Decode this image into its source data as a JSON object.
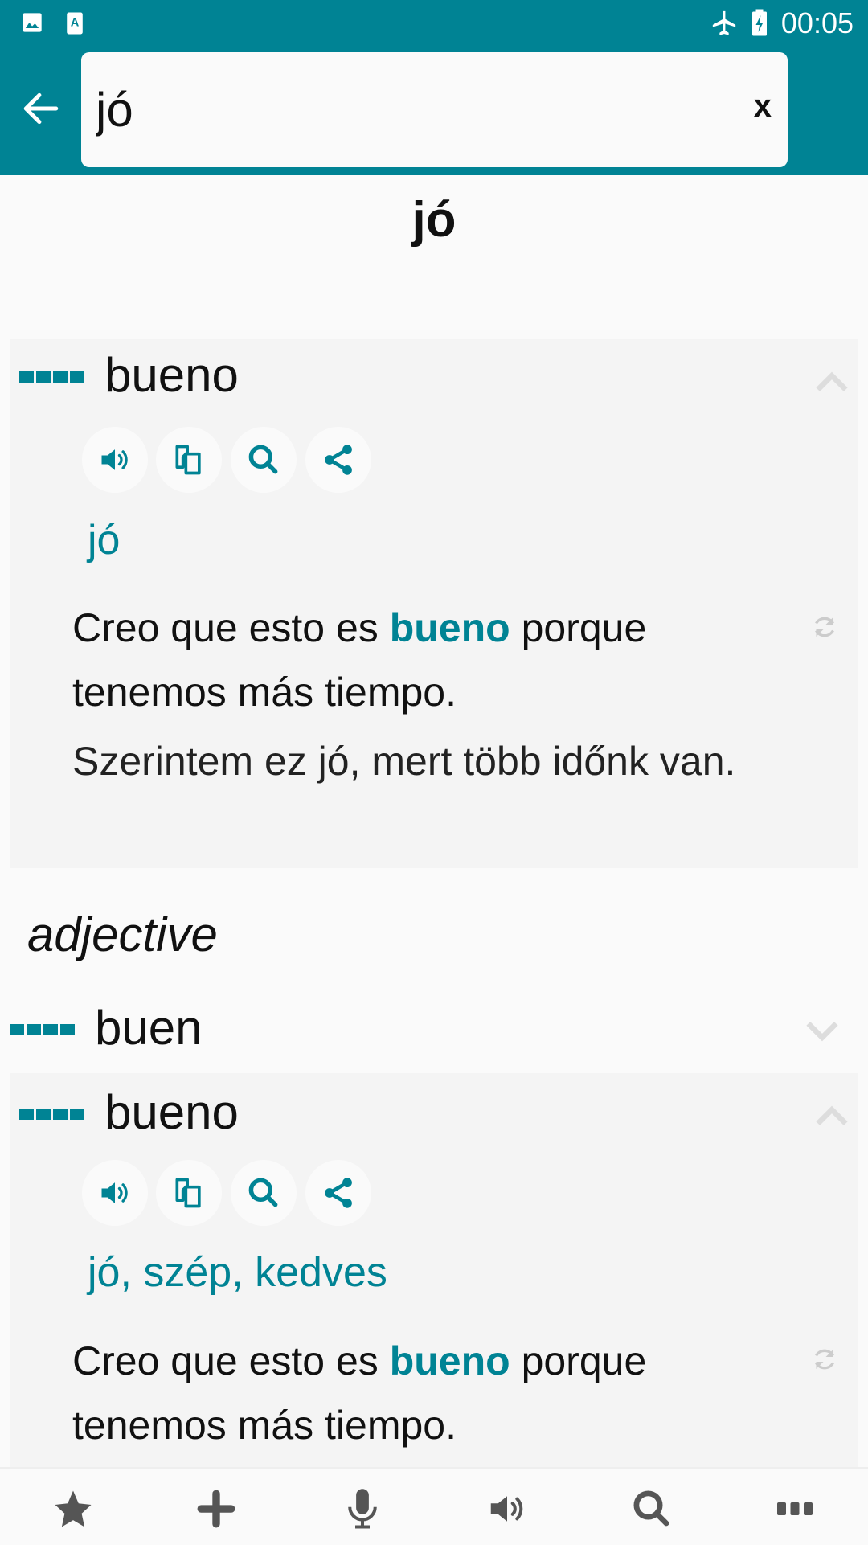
{
  "status_bar": {
    "time": "00:05",
    "icons": [
      "image-icon",
      "a-notification-icon",
      "airplane-icon",
      "battery-charging-icon"
    ]
  },
  "search": {
    "value": "jó",
    "back_icon": "arrow-left-icon",
    "clear_label": "x"
  },
  "title": "jó",
  "accent_color": "#008394",
  "entries": [
    {
      "headword": "bueno",
      "expanded": true,
      "translation": "jó",
      "example_before": "Creo que esto es ",
      "example_highlight": "bueno",
      "example_after": " porque tenemos más tiempo.",
      "example_translation": "Szerintem ez jó, mert több időnk van."
    }
  ],
  "part_of_speech": "adjective",
  "sub_entries": [
    {
      "headword": "buen",
      "expanded": false
    },
    {
      "headword": "bueno",
      "expanded": true,
      "translation": "jó, szép, kedves",
      "example_before": "Creo que esto es ",
      "example_highlight": "bueno",
      "example_after": " porque tenemos más tiempo."
    }
  ],
  "action_icons": [
    "speaker-icon",
    "copy-icon",
    "search-icon",
    "share-icon"
  ],
  "bottom_nav": [
    "star-icon",
    "plus-icon",
    "microphone-icon",
    "speaker-icon",
    "search-icon",
    "more-icon"
  ]
}
